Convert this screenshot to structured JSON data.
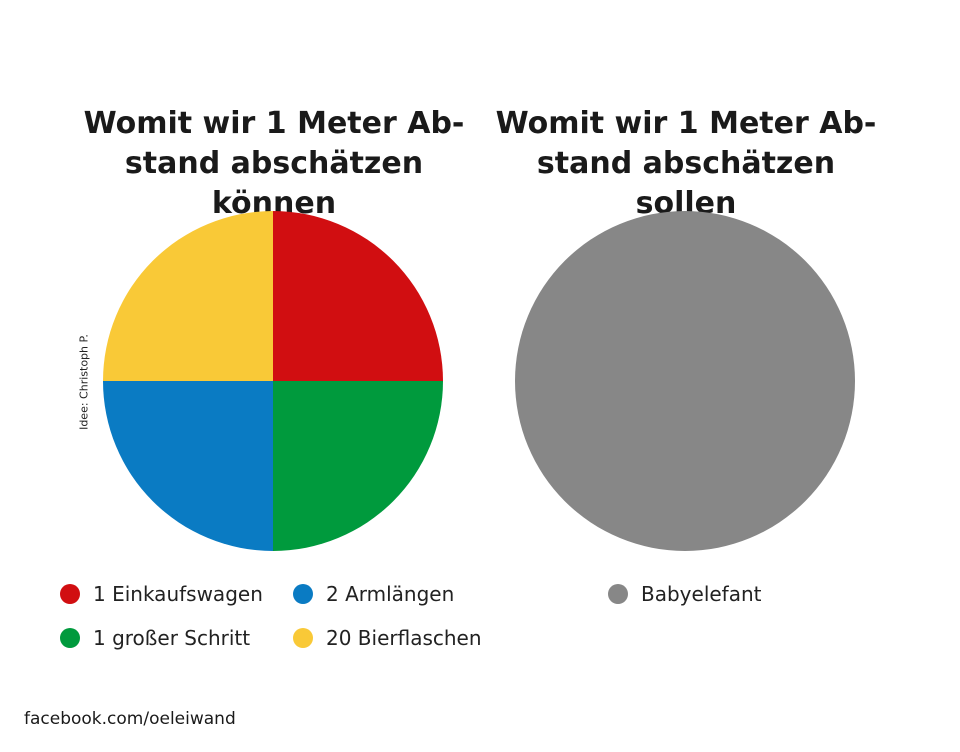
{
  "chart_data": [
    {
      "type": "pie",
      "title_lines": [
        "Womit wir 1 Meter Ab-",
        "stand abschätzen können"
      ],
      "slices": [
        {
          "label": "1 Einkaufswagen",
          "value": 25,
          "color": "#d10e11"
        },
        {
          "label": "1 großer Schritt",
          "value": 25,
          "color": "#009a3d"
        },
        {
          "label": "2 Armlängen",
          "value": 25,
          "color": "#0a7bc3"
        },
        {
          "label": "20 Bierflaschen",
          "value": 25,
          "color": "#f9c937"
        }
      ],
      "legend_placement": "bottom"
    },
    {
      "type": "pie",
      "title_lines": [
        "Womit wir 1 Meter Ab-",
        "stand abschätzen sollen"
      ],
      "slices": [
        {
          "label": "Babyelefant",
          "value": 100,
          "color": "#878787"
        }
      ],
      "legend_placement": "bottom"
    }
  ],
  "credit": "Idee: Christoph P.",
  "footer": "facebook.com/oeleiwand"
}
